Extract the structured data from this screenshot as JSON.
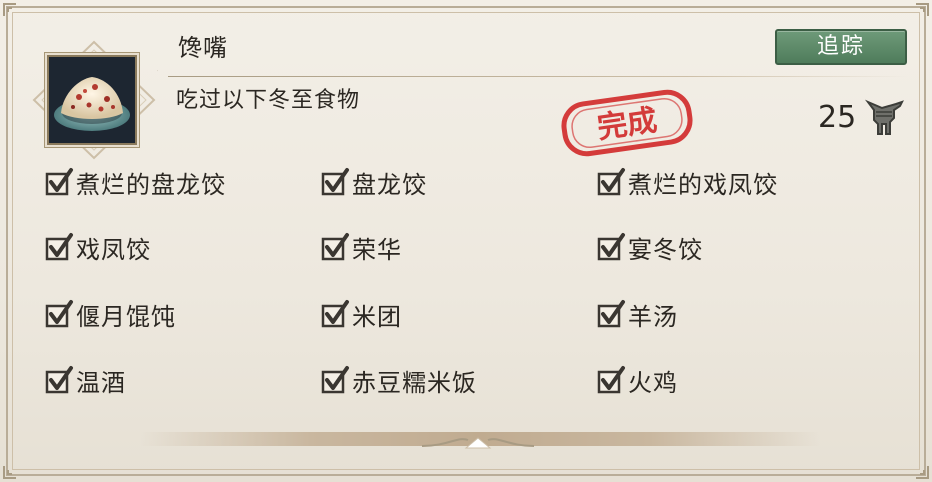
{
  "achievement": {
    "title": "馋嘴",
    "description": "吃过以下冬至食物",
    "track_button": "追踪",
    "reward_amount": "25",
    "reward_icon": "bronze-goblet-icon",
    "stamp_text": "完成",
    "stamp_color": "#d02828",
    "food_icon": "rice-dish-icon"
  },
  "items": [
    {
      "label": "煮烂的盘龙饺",
      "checked": true
    },
    {
      "label": "盘龙饺",
      "checked": true
    },
    {
      "label": "煮烂的戏凤饺",
      "checked": true
    },
    {
      "label": "戏凤饺",
      "checked": true
    },
    {
      "label": "荣华",
      "checked": true
    },
    {
      "label": "宴冬饺",
      "checked": true
    },
    {
      "label": "偃月馄饨",
      "checked": true
    },
    {
      "label": "米团",
      "checked": true
    },
    {
      "label": "羊汤",
      "checked": true
    },
    {
      "label": "温酒",
      "checked": true
    },
    {
      "label": "赤豆糯米饭",
      "checked": true
    },
    {
      "label": "火鸡",
      "checked": true
    }
  ],
  "colors": {
    "panel": "#efeae0",
    "button": "#5a8765",
    "text": "#2b2722"
  }
}
